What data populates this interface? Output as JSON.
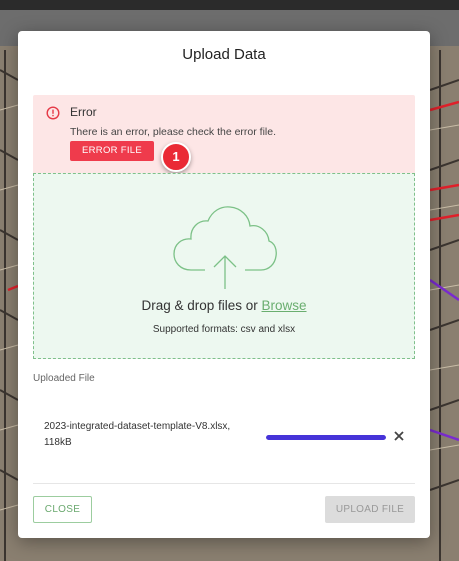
{
  "modal": {
    "title": "Upload Data"
  },
  "error": {
    "heading": "Error",
    "message": "There is an error, please check the error file.",
    "error_file_button": "ERROR FILE",
    "step_badge": "1",
    "icon": "alert-circle-icon",
    "color": "#ef3b4c"
  },
  "drop_zone": {
    "prompt": "Drag & drop files or ",
    "browse_link": "Browse",
    "formats": "Supported formats: csv and xlsx",
    "icon": "cloud-upload-icon"
  },
  "uploaded": {
    "label": "Uploaded File",
    "file_name": "2023-integrated-dataset-template-V8.xlsx,",
    "file_size": "118kB",
    "progress_percent": 100,
    "remove_icon": "close-icon"
  },
  "footer": {
    "close_button": "CLOSE",
    "upload_button": "UPLOAD FILE"
  },
  "colors": {
    "accent_green": "#6aae6f",
    "progress": "#4633d8",
    "error_bg": "#fde6e6"
  }
}
